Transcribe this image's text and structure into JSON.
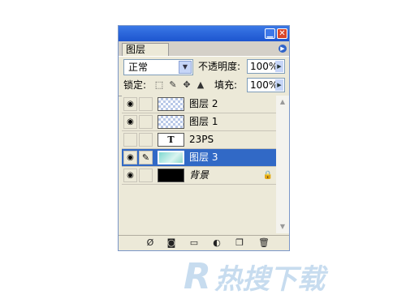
{
  "panel": {
    "tab": "图层",
    "blend_mode": "正常",
    "opacity_label": "不透明度:",
    "opacity_value": "100%",
    "lock_label": "锁定:",
    "fill_label": "填充:",
    "fill_value": "100%"
  },
  "layers": [
    {
      "name": "图层 2",
      "visible": true,
      "thumb": "checker",
      "selected": false
    },
    {
      "name": "图层 1",
      "visible": true,
      "thumb": "checker",
      "selected": false
    },
    {
      "name": "23PS",
      "visible": false,
      "thumb": "text",
      "thumb_text": "T",
      "selected": false
    },
    {
      "name": "图层 3",
      "visible": true,
      "thumb": "teal",
      "selected": true
    },
    {
      "name": "背景",
      "visible": true,
      "thumb": "black",
      "selected": false,
      "locked": true
    }
  ],
  "icons": {
    "eye": "eye-icon",
    "brush": "brush-icon",
    "lock": "lock-icon"
  },
  "watermark": {
    "letter": "R",
    "text": "热搜下载"
  },
  "colors": {
    "selected": "#3169c6",
    "titlebar": "#1d55cf"
  }
}
